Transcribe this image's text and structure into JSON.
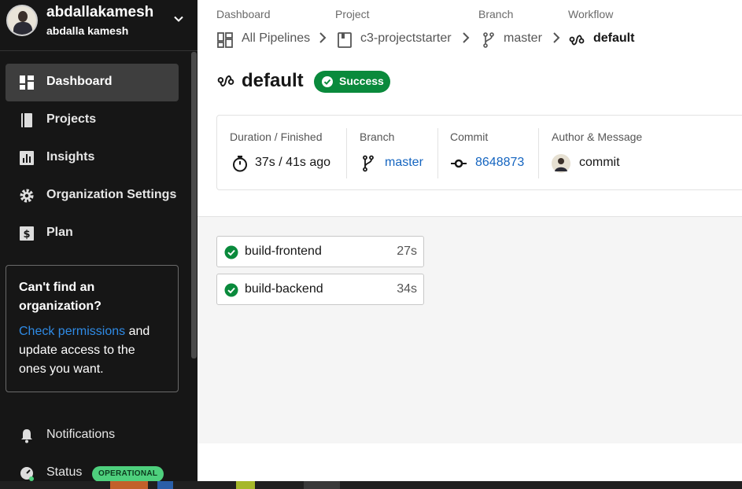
{
  "user": {
    "username": "abdallakamesh",
    "full_name": "abdalla kamesh"
  },
  "nav": [
    {
      "label": "Dashboard",
      "icon": "dashboard-icon",
      "active": true
    },
    {
      "label": "Projects",
      "icon": "book-icon",
      "active": false
    },
    {
      "label": "Insights",
      "icon": "bar-chart-icon",
      "active": false
    },
    {
      "label": "Organization Settings",
      "icon": "gear-icon",
      "active": false
    },
    {
      "label": "Plan",
      "icon": "dollar-icon",
      "active": false
    }
  ],
  "org_box": {
    "title": "Can't find an organization?",
    "link": "Check permissions",
    "message": " and update access to the ones you want."
  },
  "bottom": {
    "notifications": "Notifications",
    "status": "Status",
    "status_badge": "OPERATIONAL"
  },
  "breadcrumbs": [
    {
      "heading": "Dashboard",
      "value": "All Pipelines",
      "icon": "grid-icon"
    },
    {
      "heading": "Project",
      "value": "c3-projectstarter",
      "icon": "book-icon"
    },
    {
      "heading": "Branch",
      "value": "master",
      "icon": "branch-icon"
    },
    {
      "heading": "Workflow",
      "value": "default",
      "icon": "workflow-icon"
    }
  ],
  "workflow": {
    "title": "default",
    "status": "Success"
  },
  "summary": {
    "duration_heading": "Duration / Finished",
    "duration_value": "37s / 41s ago",
    "branch_heading": "Branch",
    "branch_value": "master",
    "commit_heading": "Commit",
    "commit_value": "8648873",
    "author_heading": "Author & Message",
    "author_value": "commit"
  },
  "jobs": [
    {
      "name": "build-frontend",
      "duration": "27s",
      "status": "success"
    },
    {
      "name": "build-backend",
      "duration": "34s",
      "status": "success"
    }
  ],
  "colors": {
    "sidebar_bg": "#161616",
    "success_green": "#0a8a3c",
    "link_blue": "#1565c0",
    "operational_green": "#4ed07d"
  }
}
